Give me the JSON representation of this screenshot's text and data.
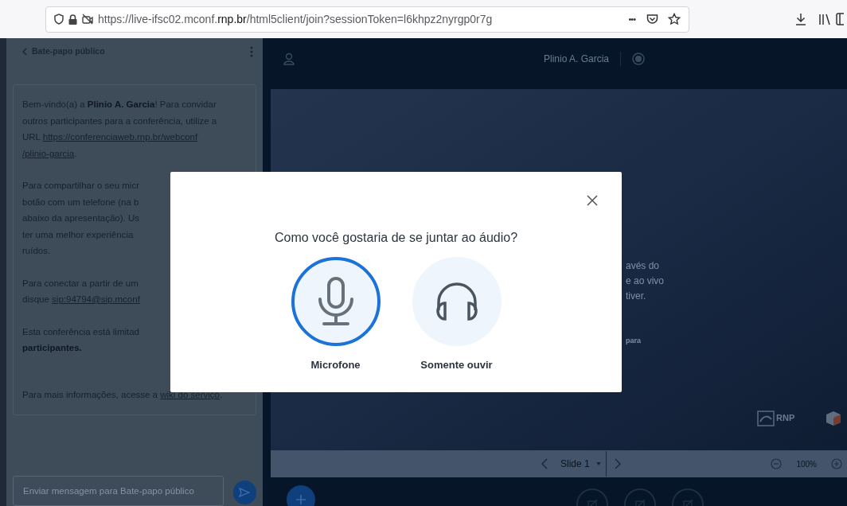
{
  "browser": {
    "url": "https://live-ifsc02.mconf.**rnp.br**/html5client/join?sessionToken=l6khpz2nyrgp0r7g",
    "more": "•••"
  },
  "chat": {
    "title": "Bate-papo público",
    "messages": [
      [
        [
          {
            "kind": "text",
            "text": "Bem-vindo(a) a "
          },
          {
            "kind": "bold",
            "text": "Plinio A. Garcia"
          },
          {
            "kind": "text",
            "text": "! Para convidar"
          }
        ],
        [
          {
            "kind": "text",
            "text": "outros participantes para a conferência, utilize a"
          }
        ],
        [
          {
            "kind": "text",
            "text": "URL "
          },
          {
            "kind": "link",
            "text": "https://conferenciaweb.rnp.br/webconf"
          }
        ],
        [
          {
            "kind": "link",
            "text": "/plinio-garcia"
          },
          {
            "kind": "text",
            "text": "."
          }
        ]
      ],
      [
        [
          {
            "kind": "text",
            "text": "Para compartilhar o seu micr"
          }
        ],
        [
          {
            "kind": "text",
            "text": "botão com um telefone (na b"
          }
        ],
        [
          {
            "kind": "text",
            "text": "abaixo da apresentação). Us"
          }
        ],
        [
          {
            "kind": "text",
            "text": "ter uma melhor experiência"
          }
        ],
        [
          {
            "kind": "text",
            "text": "ruídos."
          }
        ]
      ],
      [
        [
          {
            "kind": "text",
            "text": "Para conectar a partir de um"
          }
        ],
        [
          {
            "kind": "text",
            "text": "disque "
          },
          {
            "kind": "link",
            "text": "sip:94794@sip.mconf"
          }
        ]
      ],
      [
        [
          {
            "kind": "text",
            "text": "Esta conferência está limitad"
          }
        ],
        [
          {
            "kind": "bold",
            "text": "participantes."
          }
        ]
      ],
      [
        [
          {
            "kind": "text",
            "text": "Para mais informações, acesse a "
          },
          {
            "kind": "link",
            "text": "wiki do serviço"
          },
          {
            "kind": "text",
            "text": "."
          }
        ]
      ]
    ],
    "input": {
      "placeholder": "Enviar mensagem para Bate-papo público"
    }
  },
  "header": {
    "title": "Plinio A. Garcia"
  },
  "slide": {
    "fragments": [
      "avés do",
      "e ao vivo",
      "tiver."
    ],
    "footer_fragment": "para",
    "logo": "RNP"
  },
  "slide_controls": {
    "slide": "Slide 1",
    "zoom": "100%"
  },
  "modal": {
    "title": "Como você gostaria de se juntar ao áudio?",
    "options": [
      {
        "kind": "microphone",
        "label": "Microfone",
        "selected": true
      },
      {
        "kind": "listen",
        "label": "Somente ouvir",
        "selected": false
      }
    ]
  }
}
